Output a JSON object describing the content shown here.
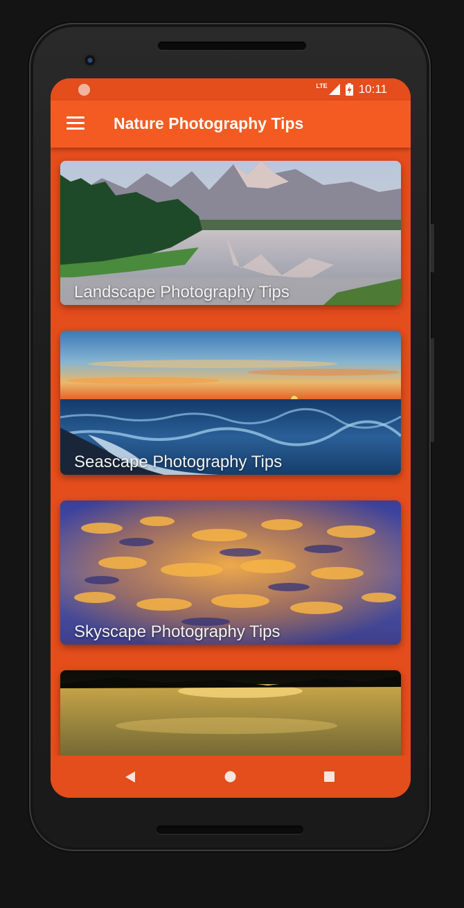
{
  "status_bar": {
    "network": "LTE",
    "time": "10:11"
  },
  "app_bar": {
    "title": "Nature Photography Tips",
    "menu_icon": "hamburger-menu-icon"
  },
  "cards": [
    {
      "label": "Landscape Photography Tips",
      "image": "mountain-lake-landscape"
    },
    {
      "label": "Seascape Photography Tips",
      "image": "ocean-sunset-seascape"
    },
    {
      "label": "Skyscape Photography Tips",
      "image": "cloudy-sky-sunset"
    },
    {
      "label": "",
      "image": "golden-lake-sunset"
    }
  ],
  "nav_bar": {
    "back_icon": "back-triangle-icon",
    "home_icon": "home-circle-icon",
    "recents_icon": "recents-square-icon"
  },
  "colors": {
    "status_bar": "#e44d1c",
    "app_bar": "#f45b22",
    "background": "#e44d1c",
    "text": "#ffffff"
  }
}
